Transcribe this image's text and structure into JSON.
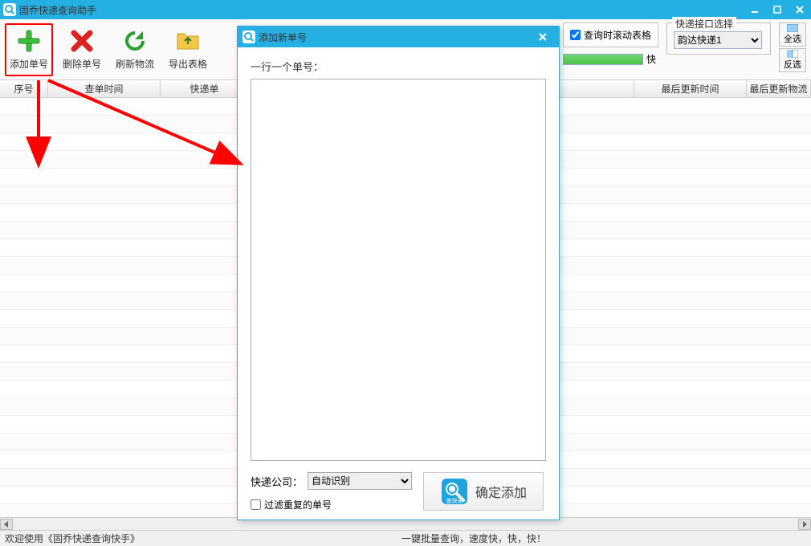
{
  "window": {
    "title": "固乔快递查询助手"
  },
  "toolbar": {
    "add": "添加单号",
    "delete": "删除单号",
    "refresh": "刷新物流",
    "export": "导出表格"
  },
  "options": {
    "scroll_checkbox_label": "查询时滚动表格",
    "scroll_checked": true,
    "progress_tail": "快",
    "interface_legend": "快递接口选择",
    "interface_selected": "韵达快递1",
    "select_all": "全选",
    "invert_sel": "反选"
  },
  "grid": {
    "col_seq": "序号",
    "col_time": "查单时间",
    "col_order": "快递单",
    "col_update": "最后更新时间",
    "col_lastlog": "最后更新物流"
  },
  "status": {
    "left": "欢迎使用《固乔快递查询快手》",
    "center": "一键批量查询，速度快，快，快！"
  },
  "modal": {
    "title": "添加新单号",
    "hint": "一行一个单号：",
    "company_label": "快递公司：",
    "company_selected": "自动识别",
    "filter_label": "过滤重复的单号",
    "filter_checked": false,
    "confirm": "确定添加",
    "confirm_icon_text": "查快递"
  }
}
